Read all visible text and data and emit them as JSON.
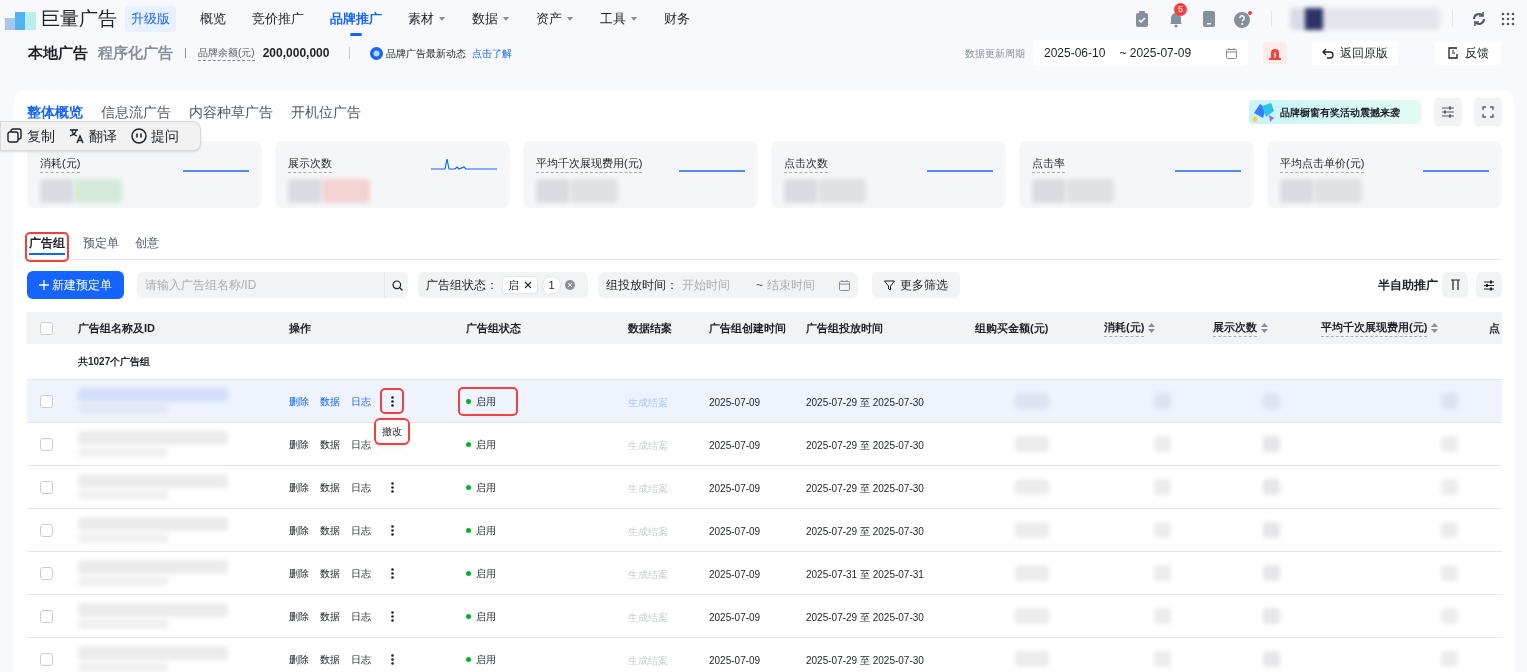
{
  "nav": {
    "logo": "巨量广告",
    "badge": "升级版",
    "notification_count": "5",
    "items": [
      {
        "label": "概览",
        "selected": false,
        "dropdown": false
      },
      {
        "label": "竞价推广",
        "selected": false,
        "dropdown": false
      },
      {
        "label": "品牌推广",
        "selected": true,
        "dropdown": false
      },
      {
        "label": "素材",
        "selected": false,
        "dropdown": true
      },
      {
        "label": "数据",
        "selected": false,
        "dropdown": true
      },
      {
        "label": "资产",
        "selected": false,
        "dropdown": true
      },
      {
        "label": "工具",
        "selected": false,
        "dropdown": true
      },
      {
        "label": "财务",
        "selected": false,
        "dropdown": false
      }
    ]
  },
  "subbar": {
    "title": "本地广告",
    "alt_title": "程序化广告",
    "balance_label": "品牌余额(元)",
    "balance": "200,000,000",
    "news": "品牌广告最新动态",
    "news_link": "点击了解",
    "period_label": "数据更新周期",
    "date_start": "2025-06-10",
    "date_end": "~ 2025-07-09",
    "back_button": "返回原版",
    "feedback_button": "反馈"
  },
  "selection_toolbar": [
    {
      "kind": "copy",
      "label": "复制"
    },
    {
      "kind": "translate",
      "label": "翻译"
    },
    {
      "kind": "ask",
      "label": "提问"
    }
  ],
  "overview_tabs": [
    {
      "label": "整体概览",
      "selected": true
    },
    {
      "label": "信息流广告",
      "selected": false
    },
    {
      "label": "内容种草广告",
      "selected": false
    },
    {
      "label": "开机位广告",
      "selected": false
    }
  ],
  "banner": "品牌橱窗有奖活动震撼来袭",
  "metrics": [
    {
      "label": "消耗(元)",
      "kind": "flat"
    },
    {
      "label": "展示次数",
      "kind": "spike"
    },
    {
      "label": "平均千次展现费用(元)",
      "kind": "flat"
    },
    {
      "label": "点击次数",
      "kind": "flat"
    },
    {
      "label": "点击率",
      "kind": "flat"
    },
    {
      "label": "平均点击单价(元)",
      "kind": "flat"
    }
  ],
  "list_tabs": [
    {
      "label": "广告组",
      "selected": true,
      "annotated": true
    },
    {
      "label": "预定单",
      "selected": false,
      "annotated": false
    },
    {
      "label": "创意",
      "selected": false,
      "annotated": false
    }
  ],
  "filters": {
    "new_button": "新建预定单",
    "search_placeholder": "请输入广告组名称/ID",
    "status_label": "广告组状态：",
    "status_tag": "启",
    "status_count": "1",
    "time_label": "组投放时间：",
    "start_placeholder": "开始时间",
    "range_sep": "~",
    "end_placeholder": "结束时间",
    "more_button": "更多筛选",
    "mode_label": "半自助推广"
  },
  "table": {
    "header_checked": false,
    "columns": [
      {
        "label": "广告组名称及ID",
        "sortable": false
      },
      {
        "label": "操作",
        "sortable": false
      },
      {
        "label": "广告组状态",
        "sortable": false
      },
      {
        "label": "数据结案",
        "sortable": false
      },
      {
        "label": "广告组创建时间",
        "sortable": false
      },
      {
        "label": "广告组投放时间",
        "sortable": false
      },
      {
        "label": "组购买金额(元)",
        "sortable": false
      },
      {
        "label": "消耗(元)",
        "sortable": true
      },
      {
        "label": "展示次数",
        "sortable": true
      },
      {
        "label": "平均千次展现费用(元)",
        "sortable": true
      },
      {
        "label": "点",
        "sortable": false
      }
    ],
    "summary": "共1027个广告组",
    "rows": [
      {
        "checked": false,
        "selected": true,
        "actions": [
          "删除",
          "数据",
          "日志"
        ],
        "more": true,
        "more_annotated": true,
        "status": "启用",
        "status_annotated": true,
        "report": "生成结案",
        "created": "2025-07-09",
        "period": "2025-07-29 至 2025-07-30"
      },
      {
        "checked": false,
        "selected": false,
        "actions": [
          "删除",
          "数据",
          "日志"
        ],
        "more": false,
        "more_annotated": false,
        "status": "启用",
        "status_annotated": false,
        "report": "生成结案",
        "created": "2025-07-09",
        "period": "2025-07-29 至 2025-07-30"
      },
      {
        "checked": false,
        "selected": false,
        "actions": [
          "删除",
          "数据",
          "日志"
        ],
        "more": true,
        "more_annotated": false,
        "status": "启用",
        "status_annotated": false,
        "report": "生成结案",
        "created": "2025-07-09",
        "period": "2025-07-29 至 2025-07-30"
      },
      {
        "checked": false,
        "selected": false,
        "actions": [
          "删除",
          "数据",
          "日志"
        ],
        "more": true,
        "more_annotated": false,
        "status": "启用",
        "status_annotated": false,
        "report": "生成结案",
        "created": "2025-07-09",
        "period": "2025-07-29 至 2025-07-30"
      },
      {
        "checked": false,
        "selected": false,
        "actions": [
          "删除",
          "数据",
          "日志"
        ],
        "more": true,
        "more_annotated": false,
        "status": "启用",
        "status_annotated": false,
        "report": "生成结案",
        "created": "2025-07-09",
        "period": "2025-07-31 至 2025-07-31"
      },
      {
        "checked": false,
        "selected": false,
        "actions": [
          "删除",
          "数据",
          "日志"
        ],
        "more": true,
        "more_annotated": false,
        "status": "启用",
        "status_annotated": false,
        "report": "生成结案",
        "created": "2025-07-09",
        "period": "2025-07-29 至 2025-07-30"
      },
      {
        "checked": false,
        "selected": false,
        "actions": [
          "删除",
          "数据",
          "日志"
        ],
        "more": true,
        "more_annotated": false,
        "status": "启用",
        "status_annotated": false,
        "report": "生成结案",
        "created": "2025-07-09",
        "period": "2025-07-29 至 2025-07-30"
      }
    ]
  },
  "row_menu": {
    "item": "撤改",
    "annotated": true
  }
}
